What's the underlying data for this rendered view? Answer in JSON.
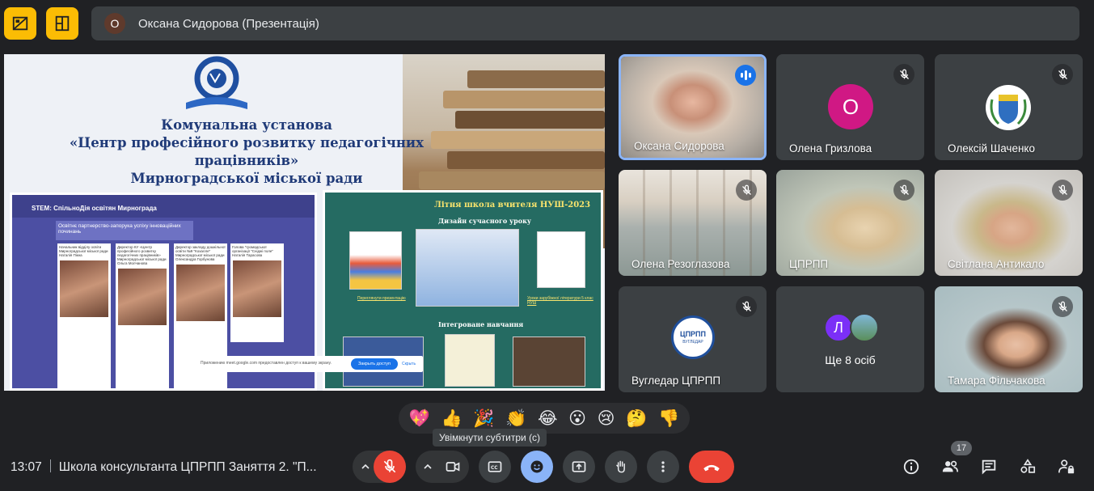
{
  "top": {
    "presenter_initial": "O",
    "presenting_label": "Оксана Сидорова (Презентація)"
  },
  "slide": {
    "title_lines": [
      "Комунальна установа",
      "«Центр професійного розвитку педагогічних",
      "працівників»",
      "Мирноградської міської ради"
    ],
    "left_panel": {
      "page_name": "STEM: СпільноДія освітян Мирнограда",
      "banner": "Освітнє партнерство-запорука успіху інноваційних починань",
      "cards": [
        "Начальник відділу освіти Мирноградської міської ради Наталія Пікна",
        "Директор КУ «Центр професійного розвитку педагогічних працівників» Мирноградської міської ради Ольга Молчанова",
        "Директор закладу дошкільної освіти №9 \"Кохалле\" Мирноградської міської ради Олександра Горбунова",
        "Голова \"громадської організації \"Сніджі поле\" Наталія Тарасова"
      ]
    },
    "right_panel": {
      "title": "Літня школа вчителя НУШ-2023",
      "section1": "Дизайн сучасного уроку",
      "section2": "Інтегроване навчання",
      "link1": "Переглянути презентацію",
      "link2": "Уроки зарубіжної літератури 5 клас НУШ"
    },
    "dialog": {
      "text": "Приложению meet.google.com предоставлен доступ к вашему экрану.",
      "ok": "Закрыть доступ",
      "hide": "Скрыть"
    }
  },
  "tiles": [
    {
      "name": "Оксана Сидорова"
    },
    {
      "name": "Олена Гризлова",
      "initial": "О"
    },
    {
      "name": "Олексій Шаченко"
    },
    {
      "name": "Олена Резоглазова"
    },
    {
      "name": "ЦПРПП"
    },
    {
      "name": "Світлана Антикало"
    },
    {
      "name": "Вугледар ЦПРПП",
      "logo_text": "ЦПРПП",
      "logo_sub": "ВУГЛЕДАР"
    },
    {
      "name": "Ще 8 осіб",
      "initial": "Л"
    },
    {
      "name": "Тамара Фільчакова"
    }
  ],
  "reactions": [
    "💖",
    "👍",
    "🎉",
    "👏",
    "😂",
    "😮",
    "😢",
    "🤔",
    "👎"
  ],
  "tooltip": "Увімкнути субтитри (c)",
  "bottom": {
    "time": "13:07",
    "meeting_title": "Школа консультанта ЦПРПП Заняття 2. \"П...",
    "participants_count": "17"
  },
  "colors": {
    "background": "#202124",
    "tile": "#3c4043",
    "hangup": "#ea4335",
    "active_border": "#8ab4f8",
    "top_buttons": "#fbbc04"
  }
}
